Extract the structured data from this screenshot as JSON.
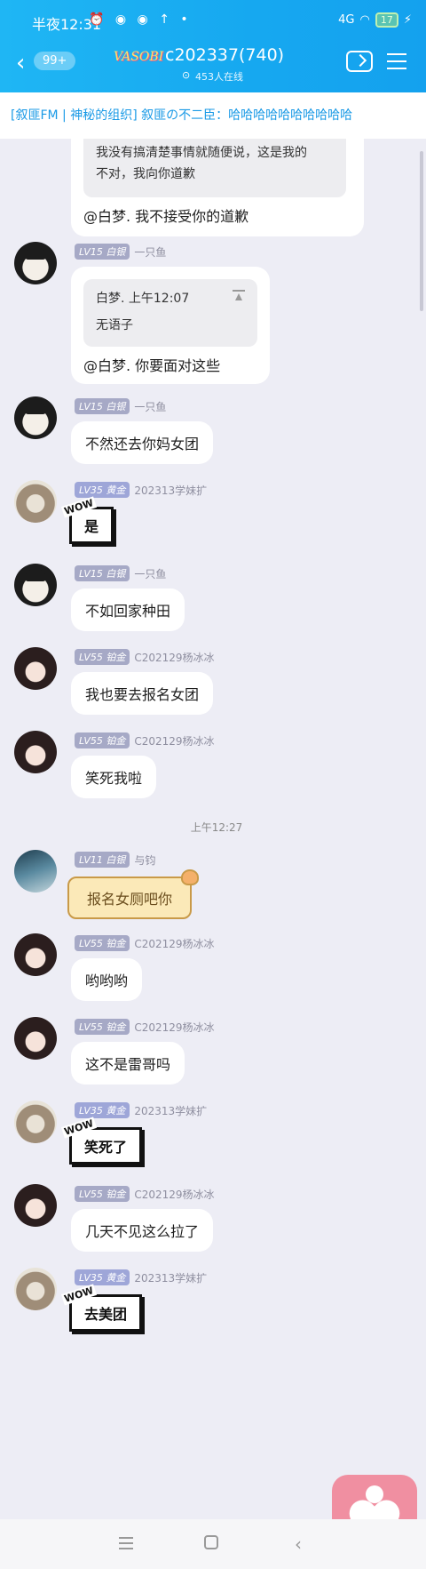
{
  "status": {
    "time": "半夜12:31",
    "icons": "⏰ ◉ ◉ ↑ •",
    "net": "4G",
    "battery": "17"
  },
  "header": {
    "unread_badge": "99+",
    "logo_text": "VASOBI",
    "title": "c202337(740)",
    "online": "453人在线"
  },
  "notice": {
    "text": "[叙匪FM | 神秘的组织] 叙匪の不二臣：哈哈哈哈哈哈哈哈哈哈"
  },
  "messages": {
    "m0": {
      "quote_text_1": "我没有搞清楚事情就随便说，这是我的",
      "quote_text_2": "不对，我向你道歉",
      "text": "@白梦. 我不接受你的道歉"
    },
    "m1": {
      "level": "LV15",
      "rank": "白银",
      "sender": "一只鱼",
      "quote_name": "白梦. 上午12:07",
      "quote_text": "无语子",
      "text": "@白梦. 你要面对这些"
    },
    "m2": {
      "level": "LV15",
      "rank": "白银",
      "sender": "一只鱼",
      "text": "不然还去你妈女团"
    },
    "m3": {
      "level": "LV35",
      "rank": "黄金",
      "sender": "202313学妹扩",
      "text": "是"
    },
    "m4": {
      "level": "LV15",
      "rank": "白银",
      "sender": "一只鱼",
      "text": "不如回家种田"
    },
    "m5": {
      "level": "LV55",
      "rank": "铂金",
      "sender": "C202129杨冰冰",
      "text": "我也要去报名女团"
    },
    "m6": {
      "level": "LV55",
      "rank": "铂金",
      "sender": "C202129杨冰冰",
      "text": "笑死我啦"
    },
    "sep": "上午12:27",
    "m7": {
      "level": "LV11",
      "rank": "白银",
      "sender": "与钧",
      "text": "报名女厕吧你"
    },
    "m8": {
      "level": "LV55",
      "rank": "铂金",
      "sender": "C202129杨冰冰",
      "text": "哟哟哟"
    },
    "m9": {
      "level": "LV55",
      "rank": "铂金",
      "sender": "C202129杨冰冰",
      "text": "这不是雷哥吗"
    },
    "m10": {
      "level": "LV35",
      "rank": "黄金",
      "sender": "202313学妹扩",
      "text": "笑死了"
    },
    "m11": {
      "level": "LV55",
      "rank": "铂金",
      "sender": "C202129杨冰冰",
      "text": "几天不见这么拉了"
    },
    "m12": {
      "level": "LV35",
      "rank": "黄金",
      "sender": "202313学妹扩",
      "text": "去美团"
    }
  },
  "wow_tag": "WOW"
}
